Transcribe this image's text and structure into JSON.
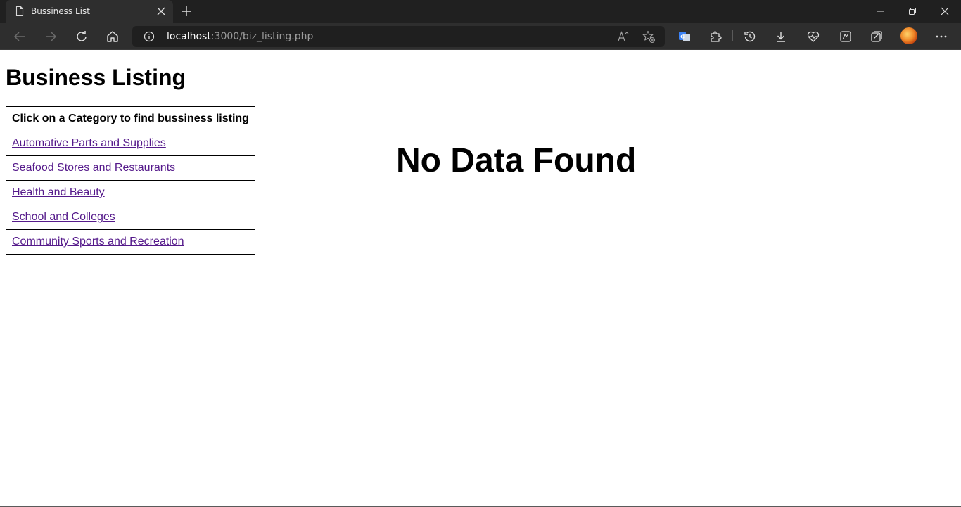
{
  "browser": {
    "tab_title": "Bussiness List",
    "url_host": "localhost",
    "url_rest": ":3000/biz_listing.php"
  },
  "page": {
    "title": "Business Listing",
    "table_header": "Click on a Category to find bussiness listing",
    "categories": [
      "Automative Parts and Supplies",
      "Seafood Stores and Restaurants",
      "Health and Beauty",
      "School and Colleges",
      "Community Sports and Recreation"
    ],
    "no_data_message": "No Data Found"
  },
  "colors": {
    "link_visited": "#551a8b",
    "chrome_dark": "#202020",
    "toolbar": "#2e2e2e"
  }
}
